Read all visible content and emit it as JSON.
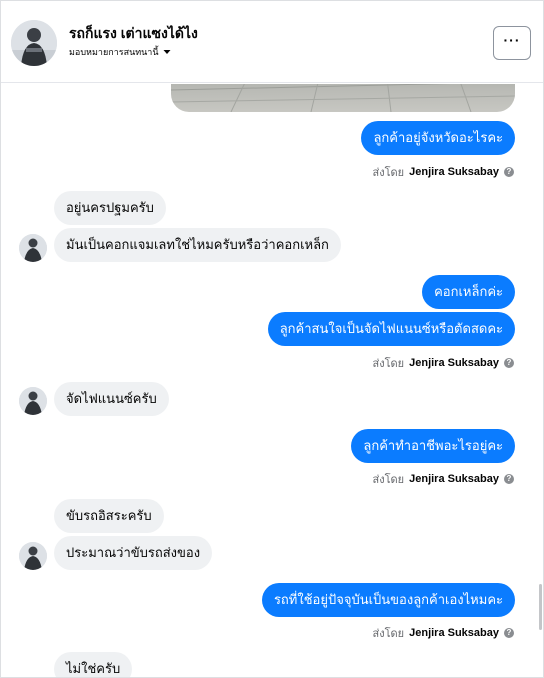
{
  "header": {
    "contact_name": "รถก็แรง เต่าแซงได้ไง",
    "status_text": "มอบหมายการสนทนานี้",
    "more_label": "···"
  },
  "messages": [
    {
      "direction": "out",
      "text": "ลูกค้าอยู่จังหวัดอะไรคะ"
    },
    {
      "type": "sent_by",
      "prefix": "ส่งโดย",
      "agent": "Jenjira Suksabay"
    },
    {
      "direction": "in",
      "text": "อยู่นครปฐมครับ"
    },
    {
      "direction": "in",
      "text": "มันเป็นคอกแจมเลทใช่ไหมครับหรือว่าคอกเหล็ก"
    },
    {
      "direction": "out",
      "text": "คอกเหล็กค่ะ"
    },
    {
      "direction": "out",
      "text": "ลูกค้าสนใจเป็นจัดไฟแนนซ์หรือตัดสดคะ"
    },
    {
      "type": "sent_by",
      "prefix": "ส่งโดย",
      "agent": "Jenjira Suksabay"
    },
    {
      "direction": "in",
      "text": "จัดไฟแนนซ์ครับ"
    },
    {
      "direction": "out",
      "text": "ลูกค้าทำอาชีพอะไรอยู่คะ"
    },
    {
      "type": "sent_by",
      "prefix": "ส่งโดย",
      "agent": "Jenjira Suksabay"
    },
    {
      "direction": "in",
      "text": "ขับรถอิสระครับ"
    },
    {
      "direction": "in",
      "text": "ประมาณว่าขับรถส่งของ"
    },
    {
      "direction": "out",
      "text": "รถที่ใช้อยู่ปัจจุบันเป็นของลูกค้าเองไหมคะ"
    },
    {
      "type": "sent_by",
      "prefix": "ส่งโดย",
      "agent": "Jenjira Suksabay"
    },
    {
      "direction": "in",
      "text": "ไม่ใช่ครับ"
    }
  ],
  "colors": {
    "outgoing_bubble": "#0b7cff",
    "incoming_bubble": "#eff1f3",
    "meta_text": "#65676b"
  },
  "icons": {
    "more": "more-options-icon",
    "help": "help-icon",
    "status_caret": "caret-down-icon"
  }
}
